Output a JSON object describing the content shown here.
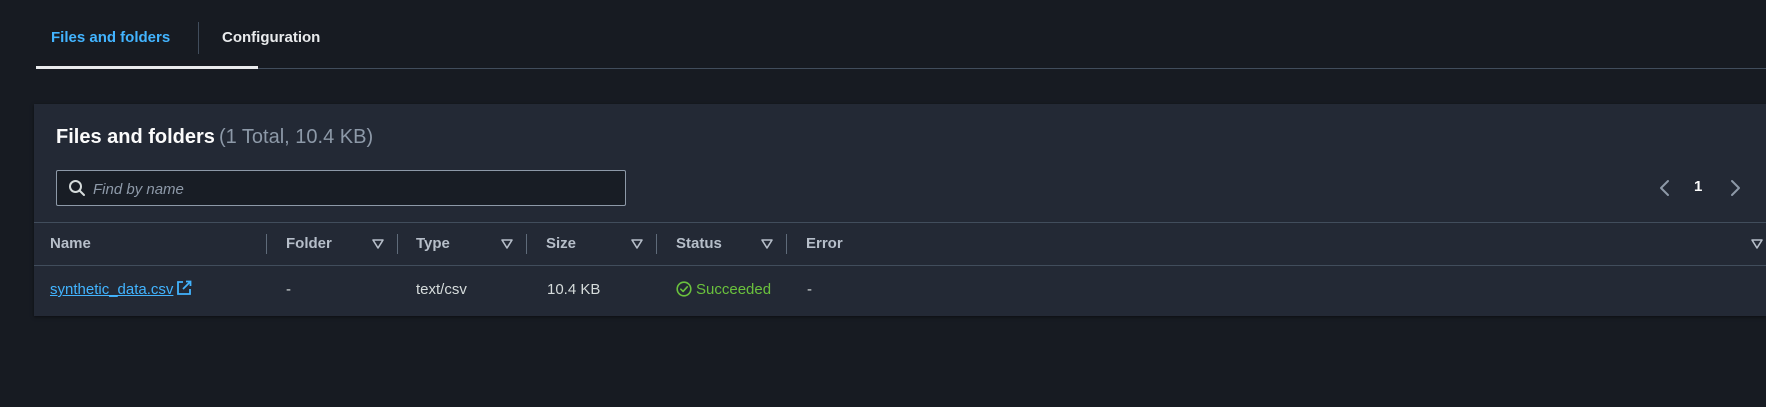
{
  "tabs": [
    {
      "label": "Files and folders",
      "active": true
    },
    {
      "label": "Configuration",
      "active": false
    }
  ],
  "panel": {
    "title": "Files and folders",
    "count": "(1 Total, 10.4 KB)"
  },
  "search": {
    "placeholder": "Find by name",
    "value": ""
  },
  "pagination": {
    "current_page": "1"
  },
  "table": {
    "columns": [
      "Name",
      "Folder",
      "Type",
      "Size",
      "Status",
      "Error"
    ],
    "rows": [
      {
        "name": "synthetic_data.csv",
        "folder": "-",
        "type": "text/csv",
        "size": "10.4 KB",
        "status": "Succeeded",
        "error": "-"
      }
    ]
  },
  "colors": {
    "background": "#171b22",
    "panel": "#232935",
    "accent": "#42b4ff",
    "success": "#6ac13d"
  },
  "icons": [
    "search-icon",
    "chevron-left-icon",
    "chevron-right-icon",
    "sort-caret-icon",
    "external-link-icon",
    "check-circle-icon"
  ]
}
